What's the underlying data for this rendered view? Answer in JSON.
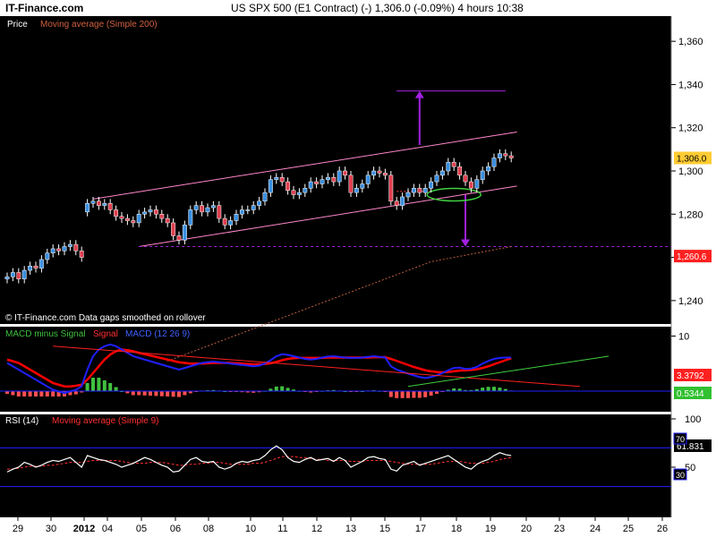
{
  "header": {
    "site": "IT-Finance.com",
    "instrument": "US SPX 500 (E1 Contract) (-)    1,306.0 (-0.09%)    4 hours  10:38"
  },
  "price_panel": {
    "label": "Price",
    "ma_label": "Moving average (Simple 200)",
    "footer_note": "© IT-Finance.com  Data gaps smoothed on rollover",
    "last_price": "1,306.0",
    "target_price": "1,260.6"
  },
  "macd_panel": {
    "label_diff": "MACD minus Signal",
    "label_signal": "Signal",
    "label_macd": "MACD (12 26 9)",
    "value_signal": "3.3792",
    "value_diff": "0.5344"
  },
  "rsi_panel": {
    "label": "RSI (14)",
    "ma_label": "Moving average (Simple 9)",
    "value": "61.831",
    "level_high": "70",
    "level_low": "30"
  },
  "colors": {
    "background": "#000000",
    "up_candle": "#3a8fe0",
    "down_candle": "#e04050",
    "channel": "#ff88cc",
    "ma200": "#c06040",
    "arrow": "#a020e0",
    "ellipse": "#40d040",
    "macd": "#2020ff",
    "signal": "#ff0000",
    "hist_pos": "#40c040",
    "hist_neg": "#ff5050",
    "rsi_line": "#ffffff",
    "rsi_ma": "#ff3030",
    "rsi_level": "#2020ff",
    "price_badge": "#ffcc33",
    "target_badge": "#ff2020",
    "signal_badge": "#ff2020",
    "diff_badge": "#30c030"
  },
  "chart_data": [
    {
      "type": "candlestick",
      "panel": "price",
      "ylim": [
        1230,
        1370
      ],
      "y_ticks": [
        1240,
        1260,
        1280,
        1300,
        1320,
        1340,
        1360
      ],
      "y_tick_labels": [
        "1,240",
        "1,260",
        "1,280",
        "1,300",
        "1,320",
        "1,340",
        "1,360"
      ],
      "x_tick_labels": [
        "29",
        "30",
        "2012",
        "04",
        "05",
        "06",
        "08",
        "10",
        "11",
        "12",
        "13",
        "15",
        "17",
        "18",
        "19",
        "20",
        "23",
        "24",
        "25",
        "26"
      ],
      "close": [
        1251,
        1253,
        1250,
        1254,
        1256,
        1255,
        1259,
        1262,
        1264,
        1263,
        1265,
        1266,
        1263,
        1260,
        1285,
        1286,
        1284,
        1285,
        1282,
        1279,
        1278,
        1277,
        1276,
        1280,
        1281,
        1282,
        1280,
        1278,
        1276,
        1270,
        1268,
        1275,
        1282,
        1284,
        1281,
        1283,
        1284,
        1278,
        1275,
        1277,
        1280,
        1282,
        1282,
        1284,
        1286,
        1290,
        1296,
        1297,
        1295,
        1291,
        1289,
        1290,
        1292,
        1295,
        1294,
        1296,
        1297,
        1295,
        1300,
        1298,
        1290,
        1292,
        1294,
        1298,
        1300,
        1299,
        1298,
        1286,
        1284,
        1288,
        1290,
        1292,
        1290,
        1292,
        1295,
        1298,
        1300,
        1304,
        1302,
        1298,
        1295,
        1292,
        1296,
        1300,
        1302,
        1306,
        1308,
        1307,
        1306
      ],
      "sma200": [
        1212,
        1213,
        1214,
        1215,
        1216,
        1217,
        1218,
        1219,
        1220,
        1221,
        1222,
        1223,
        1224,
        1225,
        1226,
        1227,
        1228,
        1229,
        1230,
        1231,
        1232,
        1233,
        1234,
        1235,
        1236,
        1237,
        1238,
        1239,
        1240,
        1241,
        1242,
        1243,
        1244,
        1245,
        1246,
        1247,
        1248,
        1249,
        1250,
        1251,
        1252,
        1253,
        1254,
        1255,
        1256,
        1257,
        1258,
        1258.5,
        1259,
        1259.5,
        1260,
        1260.5,
        1261,
        1261.5,
        1262,
        1262.5,
        1263,
        1263.5,
        1264,
        1264.5,
        1265
      ],
      "channel_upper": [
        [
          15,
          1287
        ],
        [
          89,
          1318
        ]
      ],
      "channel_lower": [
        [
          23,
          1265
        ],
        [
          89,
          1293
        ]
      ],
      "support_line": 1290.5,
      "target_line": 1265,
      "up_arrow": {
        "x": 72,
        "from": 1312,
        "to": 1337
      },
      "down_arrow": {
        "x": 80,
        "from": 1289,
        "to": 1265
      },
      "green_ellipse": {
        "x": 78,
        "y": 1289
      }
    },
    {
      "type": "line",
      "panel": "macd",
      "ylim": [
        -12,
        12
      ],
      "y_ticks": [
        10
      ],
      "series": [
        {
          "name": "MACD",
          "values": [
            2,
            1,
            0,
            -1,
            -2,
            -3,
            -4,
            -5,
            -6,
            -6.5,
            -7,
            -6.5,
            -6,
            -5,
            0,
            4,
            6,
            7,
            7.5,
            7,
            6,
            5,
            4,
            3.5,
            3,
            2.5,
            2,
            1.5,
            1,
            0.5,
            0,
            0.5,
            1,
            1.5,
            2,
            2.2,
            2.4,
            2.2,
            2,
            1.8,
            1.6,
            1.4,
            1.2,
            1,
            1.2,
            1.8,
            2.8,
            4,
            4.6,
            4.4,
            4,
            3.6,
            3.2,
            3,
            3.2,
            3.6,
            3.9,
            4,
            3.8,
            3.6,
            3.5,
            3.5,
            3.6,
            3.8,
            4,
            3.8,
            3.6,
            1,
            0,
            -0.6,
            -1.2,
            -1.7,
            -2.2,
            -2.5,
            -2.2,
            -1.7,
            -1,
            -0.2,
            0.5,
            0.6,
            0.2,
            0.3,
            0.8,
            1.8,
            2.6,
            3.2,
            3.5,
            3.6,
            3.6
          ]
        },
        {
          "name": "Signal",
          "values": [
            3,
            2.5,
            2,
            1,
            0,
            -1,
            -2,
            -3,
            -4,
            -4.5,
            -5,
            -5,
            -4.8,
            -4.5,
            -3,
            -1,
            1,
            3,
            4.5,
            5.5,
            6,
            5.8,
            5.5,
            5,
            4.6,
            4.2,
            3.8,
            3.4,
            3,
            2.6,
            2.2,
            2,
            1.8,
            1.8,
            1.8,
            1.9,
            2,
            2,
            2,
            2,
            1.9,
            1.8,
            1.7,
            1.6,
            1.6,
            1.7,
            1.9,
            2.3,
            2.8,
            3.2,
            3.4,
            3.5,
            3.5,
            3.5,
            3.5,
            3.5,
            3.6,
            3.6,
            3.6,
            3.6,
            3.6,
            3.6,
            3.6,
            3.6,
            3.7,
            3.7,
            3.7,
            3.2,
            2.6,
            2,
            1.4,
            0.8,
            0.3,
            -0.2,
            -0.5,
            -0.7,
            -0.8,
            -0.7,
            -0.5,
            -0.3,
            -0.2,
            -0.1,
            0.1,
            0.5,
            1,
            1.6,
            2.2,
            2.8,
            3.38
          ]
        }
      ]
    },
    {
      "type": "line",
      "panel": "rsi",
      "ylim": [
        0,
        100
      ],
      "y_ticks": [
        100,
        50
      ],
      "levels": [
        70,
        30
      ],
      "series": [
        {
          "name": "RSI",
          "values": [
            45,
            48,
            50,
            55,
            53,
            50,
            52,
            55,
            57,
            56,
            58,
            60,
            55,
            50,
            62,
            60,
            58,
            57,
            55,
            53,
            50,
            52,
            54,
            57,
            60,
            58,
            55,
            52,
            50,
            45,
            46,
            52,
            58,
            60,
            56,
            55,
            56,
            50,
            48,
            50,
            54,
            56,
            55,
            57,
            58,
            62,
            68,
            72,
            68,
            60,
            56,
            55,
            58,
            60,
            57,
            58,
            59,
            56,
            60,
            57,
            50,
            53,
            56,
            60,
            61,
            59,
            58,
            48,
            46,
            52,
            54,
            56,
            52,
            54,
            56,
            58,
            60,
            62,
            58,
            54,
            50,
            48,
            53,
            56,
            58,
            62,
            65,
            63,
            62
          ]
        },
        {
          "name": "Moving average (Simple 9)",
          "values": [
            48,
            48,
            49,
            50,
            51,
            51,
            51,
            52,
            52,
            53,
            54,
            55,
            55,
            55,
            56,
            57,
            57,
            57,
            57,
            57,
            56,
            55,
            54,
            54,
            54,
            55,
            55,
            55,
            54,
            53,
            52,
            52,
            53,
            53,
            54,
            54,
            55,
            55,
            54,
            53,
            53,
            53,
            53,
            54,
            54,
            55,
            57,
            59,
            61,
            61,
            61,
            60,
            60,
            59,
            58,
            58,
            57,
            57,
            57,
            57,
            56,
            56,
            56,
            57,
            57,
            57,
            57,
            56,
            55,
            54,
            53,
            53,
            53,
            53,
            53,
            54,
            55,
            56,
            56,
            56,
            55,
            54,
            54,
            54,
            55,
            56,
            58,
            59,
            60
          ]
        }
      ]
    }
  ]
}
